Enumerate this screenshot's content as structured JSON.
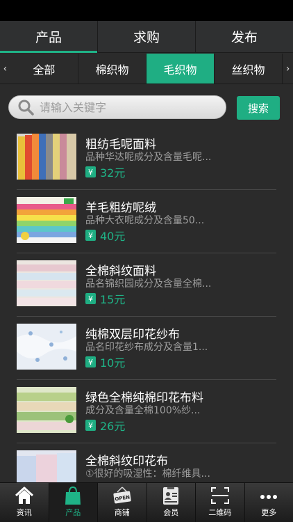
{
  "top_tabs": [
    {
      "label": "产品",
      "active": true
    },
    {
      "label": "求购",
      "active": false
    },
    {
      "label": "发布",
      "active": false
    }
  ],
  "sub_tabs": {
    "left_arrow": "‹",
    "right_arrow": "›",
    "items": [
      {
        "label": "全部",
        "active": false
      },
      {
        "label": "棉织物",
        "active": false
      },
      {
        "label": "毛织物",
        "active": true
      },
      {
        "label": "丝织物",
        "active": false
      }
    ]
  },
  "search": {
    "placeholder": "请输入关键字",
    "button_label": "搜索"
  },
  "products": [
    {
      "title": "粗纺毛呢面料",
      "desc": "品种华达呢成分及含量毛呢...",
      "yen": "¥",
      "price": "32元"
    },
    {
      "title": "羊毛粗纺呢绒",
      "desc": "品种大衣呢成分及含量50...",
      "yen": "¥",
      "price": "40元"
    },
    {
      "title": "全棉斜纹面料",
      "desc": "品名锦织园成分及含量全棉...",
      "yen": "¥",
      "price": "15元"
    },
    {
      "title": "纯棉双层印花纱布",
      "desc": "品名印花纱布成分及含量1...",
      "yen": "¥",
      "price": "10元"
    },
    {
      "title": "绿色全棉纯棉印花布料",
      "desc": "成分及含量全棉100%纱...",
      "yen": "¥",
      "price": "26元"
    },
    {
      "title": "全棉斜纹印花布",
      "desc": "①很好的吸湿性：棉纤维具...",
      "yen": "¥",
      "price": ""
    }
  ],
  "bottom_nav": [
    {
      "label": "资讯",
      "icon": "home-icon",
      "active": false
    },
    {
      "label": "产品",
      "icon": "shopping-bag-icon",
      "active": true
    },
    {
      "label": "商铺",
      "icon": "open-sign-icon",
      "active": false
    },
    {
      "label": "会员",
      "icon": "member-card-icon",
      "active": false
    },
    {
      "label": "二维码",
      "icon": "qr-scan-icon",
      "active": false
    },
    {
      "label": "更多",
      "icon": "more-dots-icon",
      "active": false
    }
  ],
  "colors": {
    "accent": "#1fae83",
    "background": "#2b2b2b"
  }
}
